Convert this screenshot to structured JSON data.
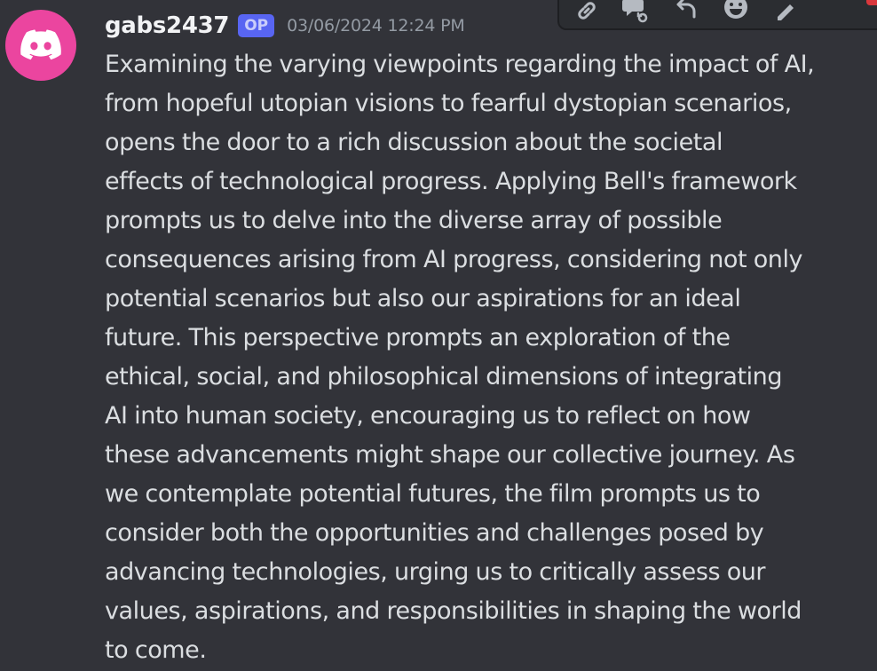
{
  "message": {
    "author": "gabs2437",
    "badge": "OP",
    "timestamp": "03/06/2024 12:24 PM",
    "content": "Examining the varying viewpoints regarding the impact of AI,\nfrom hopeful utopian visions to fearful dystopian scenarios,\nopens the door to a rich discussion about the societal\neffects of technological progress. Applying Bell's framework\nprompts us to delve into the diverse array of possible\nconsequences arising from AI progress, considering not only\npotential scenarios but also our aspirations for an ideal\nfuture. This perspective prompts an exploration of the\nethical, social, and philosophical dimensions of integrating\nAI into human society, encouraging us to reflect on how\nthese advancements might shape our collective journey. As\nwe contemplate potential futures, the film prompts us to\nconsider both the opportunities and challenges posed by\nadvancing technologies, urging us to critically assess our\nvalues, aspirations, and responsibilities in shaping the world\nto come."
  },
  "avatar": {
    "icon": "discord-logo-icon",
    "background_color": "#eb459f"
  },
  "colors": {
    "op_badge_bg": "#5865f2",
    "op_badge_text": "#c9cdfb",
    "danger": "#da373c"
  },
  "toolbar": {
    "icons": [
      "link-icon",
      "thread-icon",
      "reply-icon",
      "emoji-icon",
      "edit-icon",
      "delete-icon"
    ]
  }
}
